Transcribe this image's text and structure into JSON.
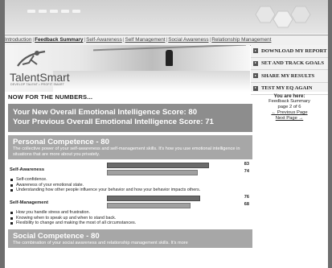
{
  "nav": {
    "links": [
      "Introduction",
      "Feedback Summary",
      "Self-Awareness",
      "Self Management",
      "Social Awareness",
      "Relationship Management"
    ],
    "active_index": 1
  },
  "logo": {
    "name": "TalentSmart",
    "tagline": "DEVELOP TALENT • PROFIT SMART"
  },
  "menu": {
    "items": [
      "DOWNLOAD MY REPORT",
      "SET AND TRACK GOALS",
      "SHARE MY RESULTS",
      "TEST MY EQ AGAIN"
    ]
  },
  "main": {
    "heading": "NOW FOR THE NUMBERS...",
    "new_score": "Your New Overall Emotional Intelligence Score: 80",
    "previous_score": "Your Previous Overall Emotional Intelligence Score: 71"
  },
  "personal": {
    "title": "Personal Competence - 80",
    "description": "The collective power of your self-awareness and self-management skills. It's how you use emotional intelligence in situations that are more about you privately.",
    "self_awareness": {
      "label": "Self-Awareness",
      "new_value": "83",
      "previous_value": "74",
      "new_pct": 83,
      "previous_pct": 74,
      "bullets": [
        "Self-confidence.",
        "Awareness of your emotional state.",
        "Understanding how other people influence your behavior and how your behavior impacts others."
      ]
    },
    "self_management": {
      "label": "Self-Management",
      "new_value": "76",
      "previous_value": "68",
      "new_pct": 76,
      "previous_pct": 68,
      "bullets": [
        "How you handle stress and frustration.",
        "Knowing when to speak up and when to stand back.",
        "Flexibility to change and making the most of all circumstances."
      ]
    }
  },
  "social": {
    "title": "Social Competence - 80",
    "description": "The combination of your social awareness and relationship management skills. It's more"
  },
  "sidebar": {
    "you_are_here": "You are here:",
    "section": "Feedback Summary",
    "page": "page 2 of 6",
    "previous": "← Previous Page",
    "next": "Next Page →"
  },
  "colors": {
    "score_bg": "#8d8d8d",
    "competence_bg": "#a7a7a7",
    "new_bar": "#6a6a6a",
    "previous_bar": "#a0a0a0"
  }
}
